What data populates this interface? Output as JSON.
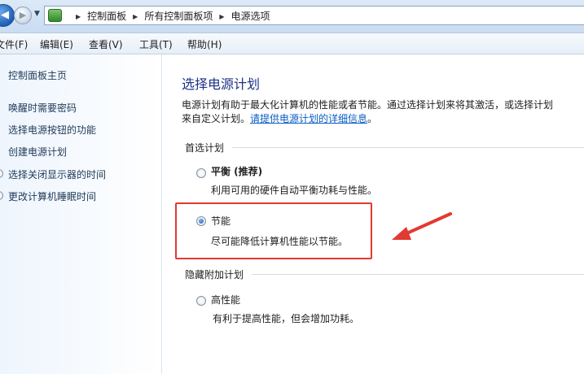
{
  "address": {
    "breadcrumbs": [
      "控制面板",
      "所有控制面板项",
      "电源选项"
    ]
  },
  "menu": [
    {
      "label": "文件(F)"
    },
    {
      "label": "编辑(E)"
    },
    {
      "label": "查看(V)"
    },
    {
      "label": "工具(T)"
    },
    {
      "label": "帮助(H)"
    }
  ],
  "sidebar": {
    "items": [
      {
        "label": "控制面板主页"
      },
      {
        "label": "唤醒时需要密码"
      },
      {
        "label": "选择电源按钮的功能"
      },
      {
        "label": "创建电源计划"
      },
      {
        "label": "选择关闭显示器的时间"
      },
      {
        "label": "更改计算机睡眠时间"
      }
    ]
  },
  "main": {
    "title": "选择电源计划",
    "desc_line1": "电源计划有助于最大化计算机的性能或者节能。通过选择计划来将其激活，或选择计划",
    "desc_line2_prefix": "来自定义计划。",
    "desc_link": "请提供电源计划的详细信息",
    "desc_line2_suffix": "。",
    "preferred_heading": "首选计划",
    "hidden_heading": "隐藏附加计划",
    "plans": {
      "balanced": {
        "name": "平衡 (推荐)",
        "desc": "利用可用的硬件自动平衡功耗与性能。",
        "selected": false
      },
      "saver": {
        "name": "节能",
        "desc": "尽可能降低计算机性能以节能。",
        "selected": true
      },
      "high": {
        "name": "高性能",
        "desc": "有利于提高性能，但会增加功耗。",
        "selected": false
      }
    }
  },
  "annotation": {
    "highlight_color": "#e23a32"
  }
}
